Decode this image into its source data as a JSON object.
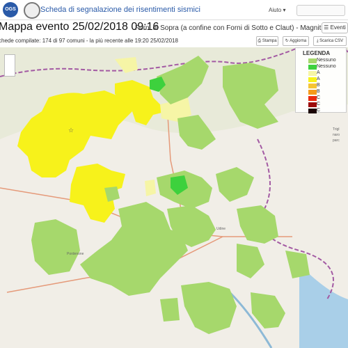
{
  "app": {
    "logo_text": "OGS",
    "title": "Scheda di segnalazione dei risentimenti sismici",
    "help_menu": "Aiuto ▾"
  },
  "header": {
    "map_title": "Mappa evento 25/02/2018 09:16",
    "subtitle": "Forni di Sopra (a confine con Forni di Sotto e Claut) - Magnitudo:",
    "events_button": "Eventi"
  },
  "summary": {
    "text": "chede compilate: 174 di 97 comuni - la più recente alle 19:20 25/02/2018"
  },
  "toolbar": {
    "print_label": "Stampa",
    "refresh_label": "Aggiorna",
    "csv_label": "Scarica CSV"
  },
  "legend": {
    "title": "LEGENDA",
    "items": [
      {
        "label": "Nessuno",
        "color": "#a6d86c"
      },
      {
        "label": "Nessuno",
        "color": "#3dd13d"
      },
      {
        "label": "A",
        "color": "#f6f5a6"
      },
      {
        "label": "A",
        "color": "#f7f21b"
      },
      {
        "label": "B",
        "color": "#f6c533"
      },
      {
        "label": "B",
        "color": "#f59b1b"
      },
      {
        "label": "C",
        "color": "#ea2b10"
      },
      {
        "label": "C",
        "color": "#9c0b0b"
      },
      {
        "label": "C",
        "color": "#1b0505"
      }
    ]
  },
  "map": {
    "labels": [
      "Trigl",
      "naro",
      "parc",
      "Udine",
      "Pordenone"
    ]
  }
}
